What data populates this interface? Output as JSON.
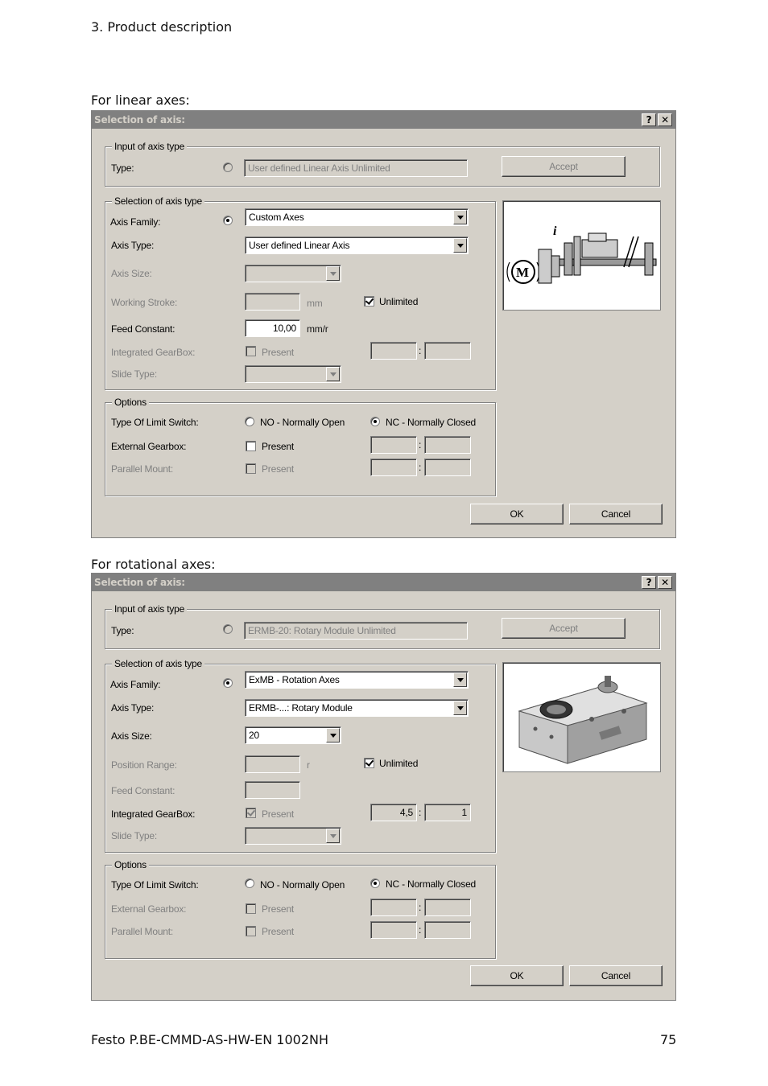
{
  "header": "3. Product description",
  "footer": {
    "doc_id": "Festo P.BE-CMMD-AS-HW-EN 1002NH",
    "page_number": "75"
  },
  "section_linear": "For linear axes:",
  "section_rotational": "For rotational axes:",
  "dialog_common": {
    "title": "Selection of axis:",
    "help": "?",
    "close": "✕",
    "input_group": "Input of axis type",
    "type_label": "Type:",
    "accept": "Accept",
    "selection_group": "Selection of axis type",
    "axis_family_label": "Axis Family:",
    "axis_type_label": "Axis Type:",
    "axis_size_label": "Axis Size:",
    "unlimited_label": "Unlimited",
    "feed_constant_label": "Feed Constant:",
    "integrated_gearbox_label": "Integrated GearBox:",
    "present": "Present",
    "slide_type_label": "Slide Type:",
    "options_group": "Options",
    "limit_switch_label": "Type Of Limit Switch:",
    "no_label": "NO - Normally Open",
    "nc_label": "NC - Normally Closed",
    "external_gearbox_label": "External Gearbox:",
    "parallel_mount_label": "Parallel Mount:",
    "colon": ":",
    "ok": "OK",
    "cancel": "Cancel"
  },
  "linear": {
    "type_value": "User defined Linear Axis Unlimited",
    "axis_family": "Custom Axes",
    "axis_type": "User defined Linear Axis",
    "stroke_label": "Working Stroke:",
    "stroke_unit": "mm",
    "feed_constant_value": "10,00",
    "feed_unit": "mm/r",
    "picture": "linear-axis-diagram"
  },
  "rotational": {
    "type_value": "ERMB-20: Rotary Module Unlimited",
    "axis_family": "ExMB - Rotation Axes",
    "axis_type": "ERMB-...: Rotary Module",
    "axis_size": "20",
    "stroke_label": "Position Range:",
    "stroke_unit": "r",
    "gear_num": "4,5",
    "gear_den": "1",
    "picture": "rotary-module-photo"
  }
}
